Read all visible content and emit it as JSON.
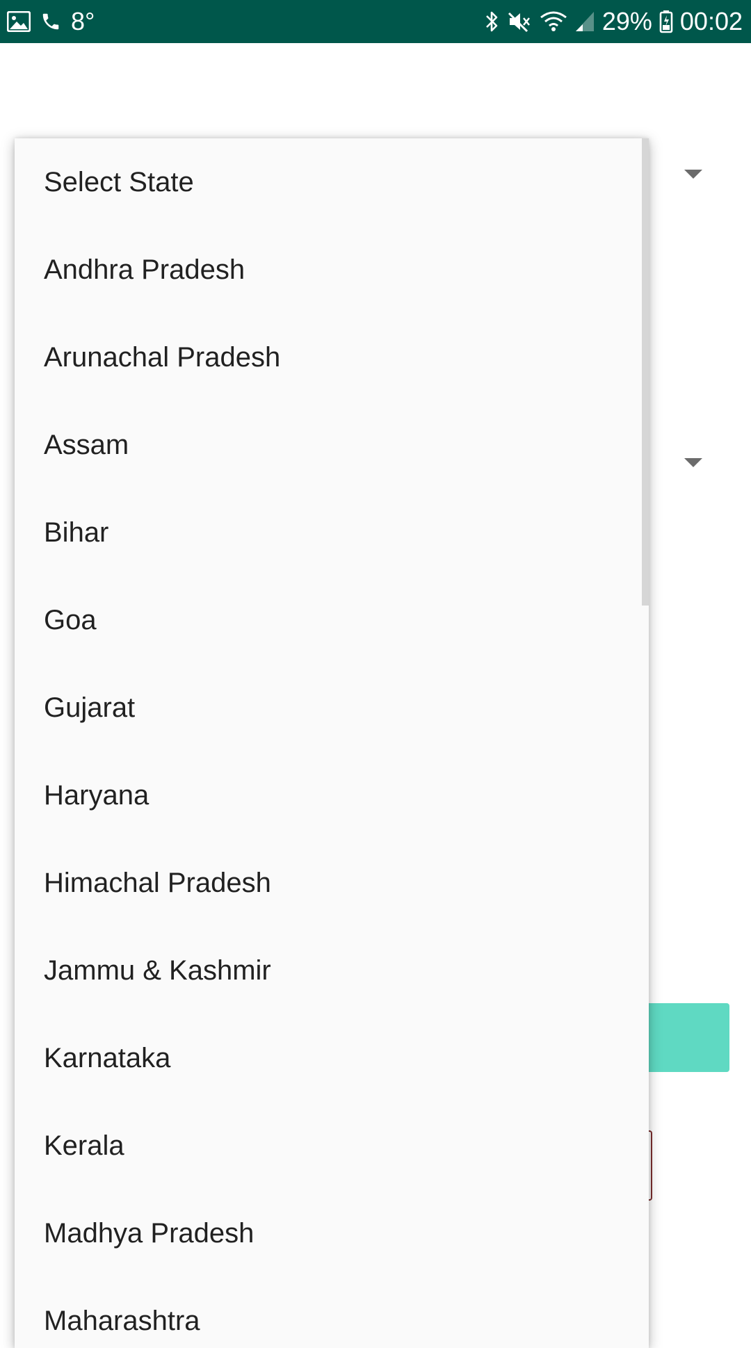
{
  "status_bar": {
    "temperature": "8°",
    "battery": "29%",
    "time": "00:02",
    "icons_left": [
      "gallery-icon",
      "phone-icon"
    ],
    "icons_right": [
      "bluetooth-icon",
      "mute-icon",
      "wifi-icon",
      "signal-icon",
      "battery-icon"
    ]
  },
  "colors": {
    "status_bar": "#00574b",
    "accent_button": "#5fd9c2",
    "dropdown_bg": "#fafafa",
    "item_text": "#212121"
  },
  "dropdown": {
    "items": [
      "Select State",
      "Andhra Pradesh",
      "Arunachal Pradesh",
      "Assam",
      "Bihar",
      "Goa",
      "Gujarat",
      "Haryana",
      "Himachal Pradesh",
      "Jammu & Kashmir",
      "Karnataka",
      "Kerala",
      "Madhya Pradesh",
      "Maharashtra"
    ]
  }
}
